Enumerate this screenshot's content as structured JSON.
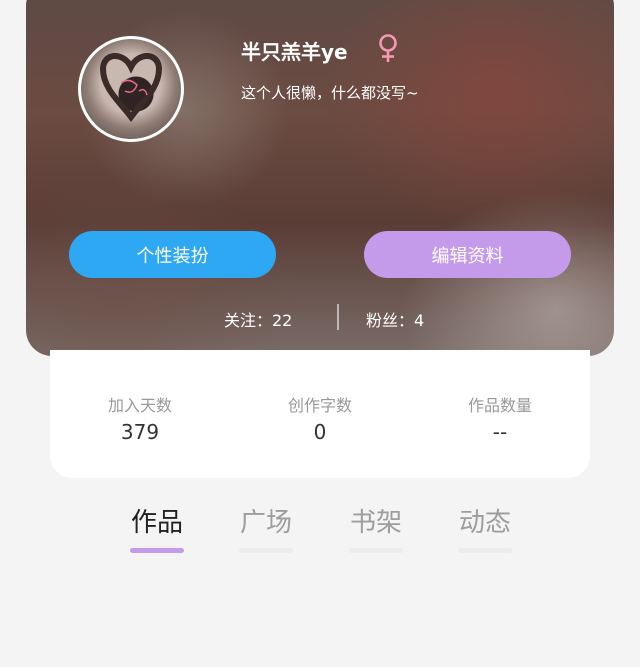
{
  "profile": {
    "username": "半只羔羊ye",
    "bio": "这个人很懒，什么都没写~",
    "gender_icon": "female-icon",
    "gender_color": "#f29ab5"
  },
  "buttons": {
    "style_label": "个性装扮",
    "edit_label": "编辑资料"
  },
  "follow": {
    "following_text": "关注：22",
    "fans_text": "粉丝：4"
  },
  "stats": [
    {
      "label": "加入天数",
      "value": "379"
    },
    {
      "label": "创作字数",
      "value": "0"
    },
    {
      "label": "作品数量",
      "value": "--"
    }
  ],
  "tabs": [
    {
      "label": "作品",
      "active": true
    },
    {
      "label": "广场",
      "active": false
    },
    {
      "label": "书架",
      "active": false
    },
    {
      "label": "动态",
      "active": false
    }
  ],
  "colors": {
    "accent_blue": "#2fa8f4",
    "accent_purple": "#c49bea"
  }
}
